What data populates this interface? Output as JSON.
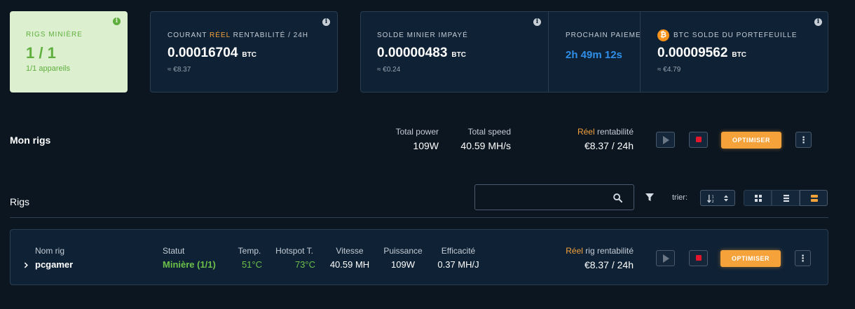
{
  "summary": {
    "rigs": {
      "label": "RIGS MINIÈRE",
      "value": "1 / 1",
      "sub": "1/1 appareils"
    },
    "profit": {
      "label_prefix": "COURANT ",
      "label_highlight": "RÉEL",
      "label_suffix": " RENTABILITÉ / 24H",
      "value": "0.00016704",
      "unit": "BTC",
      "fiat": "≈ €8.37"
    },
    "unpaid": {
      "label": "SOLDE MINIER IMPAYÉ",
      "value": "0.00000483",
      "unit": "BTC",
      "fiat": "≈ €0.24"
    },
    "next_payment": {
      "label": "PROCHAIN PAIEMENT",
      "value": "2h 49m 12s"
    },
    "wallet": {
      "label": "BTC SOLDE DU PORTEFEUILLE",
      "value": "0.00009562",
      "unit": "BTC",
      "fiat": "≈ €4.79"
    }
  },
  "my_rigs": {
    "title": "Mon rigs",
    "total_power_label": "Total power",
    "total_power_value": "109W",
    "total_speed_label": "Total speed",
    "total_speed_value": "40.59 MH/s",
    "profit_label_highlight": "Réel",
    "profit_label_rest": " rentabilité",
    "profit_value": "€8.37 / 24h",
    "optimize_label": "OPTIMISER"
  },
  "rigs_section": {
    "title": "Rigs",
    "search_placeholder": "",
    "sort_label": "trier:"
  },
  "rig_row": {
    "name_label": "Nom rig",
    "name_value": "pcgamer",
    "status_label": "Statut",
    "status_value": "Minière (1/1)",
    "temp_label": "Temp.",
    "temp_value": "51°C",
    "hotspot_label": "Hotspot T.",
    "hotspot_value": "73°C",
    "speed_label": "Vitesse",
    "speed_value": "40.59 MH",
    "power_label": "Puissance",
    "power_value": "109W",
    "efficiency_label": "Efficacité",
    "efficiency_value": "0.37 MH/J",
    "profit_label_highlight": "Réel",
    "profit_label_rest": " rig rentabilité",
    "profit_value": "€8.37 / 24h",
    "optimize_label": "OPTIMISER"
  },
  "colors": {
    "accent_orange": "#f6a23a",
    "green": "#6cc04a",
    "blue_timer": "#2f8fe8",
    "stop_red": "#e3162b"
  },
  "icons": [
    "info-icon",
    "bitcoin-icon",
    "play-icon",
    "stop-icon",
    "more-vertical-icon",
    "search-icon",
    "filter-icon",
    "sort-icon",
    "grid-view-icon",
    "list-view-icon",
    "card-view-icon",
    "chevron-right-icon"
  ]
}
